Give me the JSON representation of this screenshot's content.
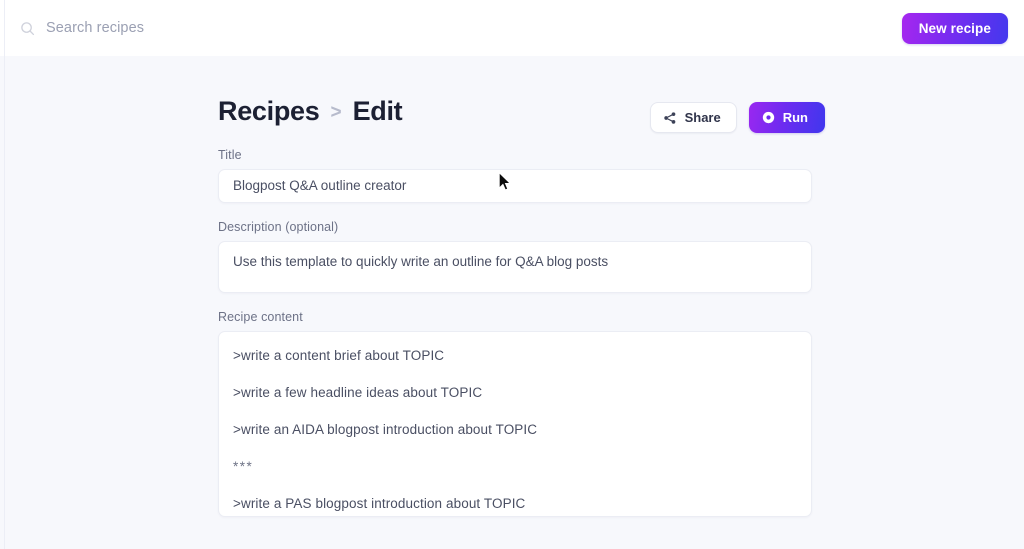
{
  "topbar": {
    "search": {
      "placeholder": "Search recipes",
      "value": "",
      "icon": "search-icon"
    },
    "new_recipe_label": "New recipe"
  },
  "page": {
    "breadcrumb": {
      "parent": "Recipes",
      "separator": ">",
      "current": "Edit"
    },
    "actions": {
      "share_label": "Share",
      "share_icon": "share-nodes-icon",
      "run_label": "Run",
      "run_icon": "play-circle-icon"
    }
  },
  "form": {
    "title": {
      "label": "Title",
      "value": "Blogpost Q&A outline creator"
    },
    "description": {
      "label": "Description (optional)",
      "value": "Use this template to quickly write an outline for Q&A blog posts"
    },
    "recipe_content": {
      "label": "Recipe content",
      "lines": [
        ">write a content brief about TOPIC",
        ">write a few headline ideas about TOPIC",
        ">write an AIDA blogpost introduction about TOPIC",
        "***",
        ">write a PAS blogpost introduction about TOPIC"
      ]
    }
  },
  "theme": {
    "background": "#f7f8fc",
    "surface": "#ffffff",
    "accent_purple": "#9a28f0",
    "accent_blue": "#4037ee",
    "text_primary": "#1c2033",
    "text_muted": "#6d7287"
  }
}
